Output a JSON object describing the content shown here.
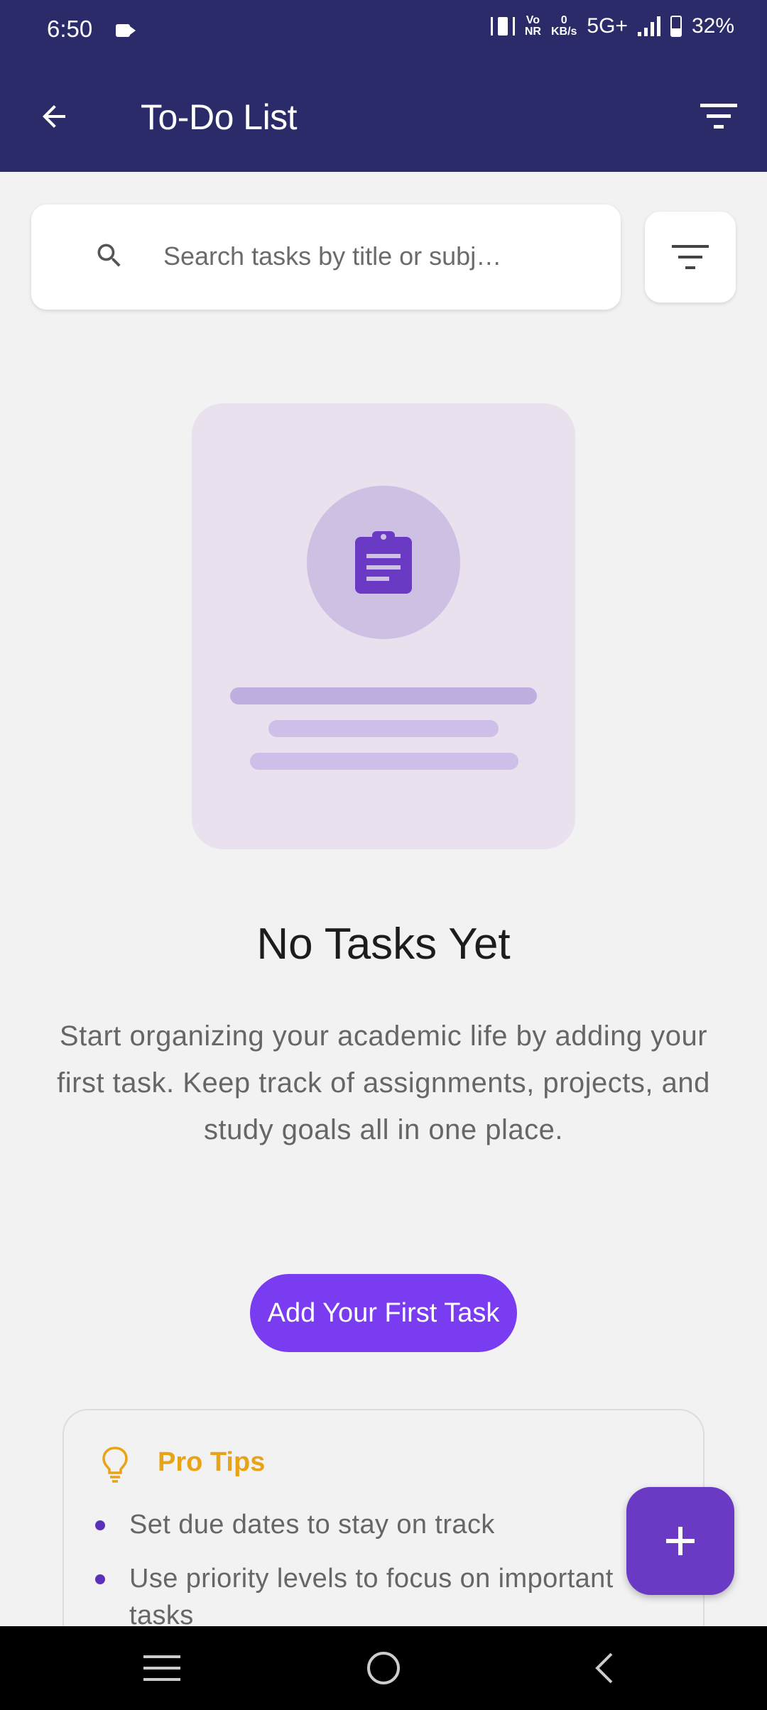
{
  "status_bar": {
    "time": "6:50",
    "vonr_top": "Vo",
    "vonr_bottom": "NR",
    "speed_top": "0",
    "speed_bottom": "KB/s",
    "network": "5G+",
    "battery": "32%"
  },
  "app_bar": {
    "title": "To-Do List",
    "background": "#2b2b69"
  },
  "search": {
    "placeholder": "Search tasks by title or subj…",
    "value": ""
  },
  "empty_state": {
    "title": "No Tasks Yet",
    "description": "Start organizing your academic life by adding your first task. Keep track of assignments, projects, and study goals all in one place.",
    "button_label": "Add Your First Task",
    "accent": "#7a3cf0"
  },
  "pro_tips": {
    "title": "Pro Tips",
    "title_color": "#e8a317",
    "items": [
      "Set due dates to stay on track",
      "Use priority levels to focus on important",
      "tasks"
    ]
  },
  "fab": {
    "icon": "plus-icon",
    "color": "#6a3ac4"
  },
  "nav_bar": {
    "icons": [
      "recents-icon",
      "home-icon",
      "back-icon"
    ]
  }
}
